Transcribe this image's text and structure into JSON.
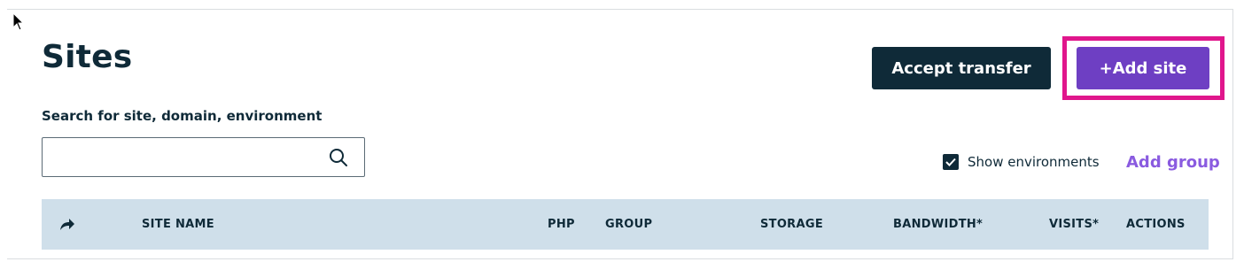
{
  "page": {
    "title": "Sites"
  },
  "toolbar": {
    "accept_transfer_label": "Accept transfer",
    "add_site_label": "+Add site"
  },
  "search": {
    "label": "Search for site, domain, environment",
    "value": "",
    "placeholder": ""
  },
  "filters": {
    "show_environments_label": "Show environments",
    "show_environments_checked": true,
    "add_group_label": "Add group"
  },
  "table": {
    "columns": [
      "SITE NAME",
      "PHP",
      "GROUP",
      "STORAGE",
      "BANDWIDTH*",
      "VISITS*",
      "ACTIONS"
    ],
    "header_icon": "share-arrow-icon"
  },
  "colors": {
    "primary_dark": "#0f2a38",
    "accent_purple": "#6e3fc3",
    "link_purple": "#8a5be0",
    "highlight": "#e0168c",
    "table_header_bg": "#cfdfea"
  }
}
